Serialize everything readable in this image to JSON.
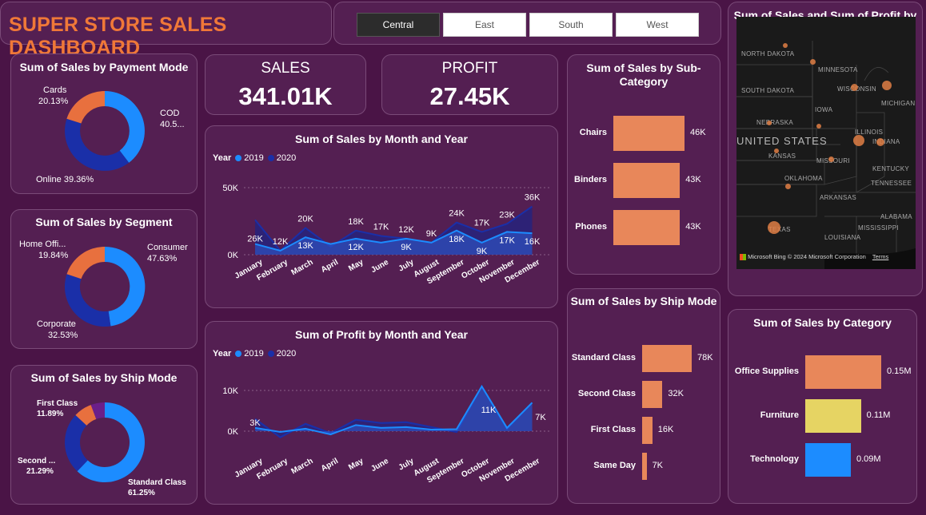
{
  "header": {
    "title": "SUPER STORE SALES DASHBOARD"
  },
  "slicer": {
    "options": [
      "Central",
      "East",
      "South",
      "West"
    ],
    "selected": "Central"
  },
  "kpis": {
    "sales": {
      "label": "SALES",
      "value": "341.01K"
    },
    "profit": {
      "label": "PROFIT",
      "value": "27.45K"
    }
  },
  "payment_mode": {
    "title": "Sum of Sales by Payment Mode",
    "labels": {
      "cards_name": "Cards",
      "cards_pct": "20.13%",
      "cod_name": "COD",
      "cod_pct": "40.5...",
      "online": "Online 39.36%"
    }
  },
  "segment": {
    "title": "Sum of Sales by Segment",
    "labels": {
      "home_name": "Home Offi...",
      "home_pct": "19.84%",
      "consumer_name": "Consumer",
      "consumer_pct": "47.63%",
      "corporate_name": "Corporate",
      "corporate_pct": "32.53%"
    }
  },
  "ship_donut": {
    "title": "Sum of Sales by Ship Mode",
    "labels": {
      "first_name": "First Class",
      "first_pct": "11.89%",
      "second_name": "Second ...",
      "second_pct": "21.29%",
      "standard_name": "Standard Class",
      "standard_pct": "61.25%"
    }
  },
  "sales_month": {
    "title": "Sum of Sales by Month and Year",
    "legend_title": "Year",
    "legend": [
      "2019",
      "2020"
    ],
    "yticks": [
      "50K",
      "0K"
    ],
    "months": [
      "January",
      "February",
      "March",
      "April",
      "May",
      "June",
      "July",
      "August",
      "September",
      "October",
      "November",
      "December"
    ],
    "labels_2019": [
      "",
      "12K",
      "13K",
      "",
      "12K",
      "",
      "9K",
      "",
      "18K",
      "9K",
      "17K",
      "16K"
    ],
    "labels_2020": [
      "26K",
      "",
      "20K",
      "",
      "18K",
      "17K",
      "12K",
      "9K",
      "24K",
      "17K",
      "23K",
      "36K"
    ]
  },
  "profit_month": {
    "title": "Sum of Profit by Month and Year",
    "legend_title": "Year",
    "legend": [
      "2019",
      "2020"
    ],
    "yticks": [
      "10K",
      "0K"
    ],
    "months": [
      "January",
      "February",
      "March",
      "April",
      "May",
      "June",
      "July",
      "August",
      "September",
      "October",
      "November",
      "December"
    ],
    "labels": {
      "jan": "3K",
      "oct": "11K",
      "dec": "7K"
    }
  },
  "subcategory": {
    "title": "Sum of Sales by Sub-Category",
    "bars": [
      {
        "name": "Chairs",
        "value": "46K"
      },
      {
        "name": "Binders",
        "value": "43K"
      },
      {
        "name": "Phones",
        "value": "43K"
      }
    ]
  },
  "shipmode_bar": {
    "title": "Sum of Sales by Ship Mode",
    "bars": [
      {
        "name": "Standard Class",
        "value": "78K"
      },
      {
        "name": "Second Class",
        "value": "32K"
      },
      {
        "name": "First Class",
        "value": "16K"
      },
      {
        "name": "Same Day",
        "value": "7K"
      }
    ]
  },
  "map": {
    "title": "Sum of Sales and Sum of Profit by State",
    "states": [
      "NORTH DAKOTA",
      "MINNESOTA",
      "SOUTH DAKOTA",
      "WISCONSIN",
      "MICHIGAN",
      "IOWA",
      "NEBRASKA",
      "UNITED STATES",
      "ILLINOIS",
      "INDIANA",
      "KANSAS",
      "MISSOURI",
      "KENTUCKY",
      "OKLAHOMA",
      "TENNESSEE",
      "ARKANSAS",
      "ALABAMA",
      "MISSISSIPPI",
      "TEXAS",
      "LOUISIANA"
    ],
    "attribution": {
      "bing": "Microsoft Bing",
      "copyright": "© 2024 Microsoft Corporation",
      "terms": "Terms"
    }
  },
  "category": {
    "title": "Sum of Sales by Category",
    "bars": [
      {
        "name": "Office Supplies",
        "value": "0.15M"
      },
      {
        "name": "Furniture",
        "value": "0.11M"
      },
      {
        "name": "Technology",
        "value": "0.09M"
      }
    ]
  },
  "colors": {
    "orange": "#e8875a",
    "blue_light": "#1c8cff",
    "navy": "#1a2fa8",
    "yellow": "#e6d463",
    "purple": "#6b1f8a",
    "card": "#541f52"
  },
  "chart_data": [
    {
      "type": "pie",
      "title": "Sum of Sales by Payment Mode",
      "categories": [
        "COD",
        "Online",
        "Cards"
      ],
      "values": [
        40.51,
        39.36,
        20.13
      ]
    },
    {
      "type": "pie",
      "title": "Sum of Sales by Segment",
      "categories": [
        "Consumer",
        "Corporate",
        "Home Office"
      ],
      "values": [
        47.63,
        32.53,
        19.84
      ]
    },
    {
      "type": "pie",
      "title": "Sum of Sales by Ship Mode",
      "categories": [
        "Standard Class",
        "Second Class",
        "First Class",
        "Same Day"
      ],
      "values": [
        61.25,
        21.29,
        11.89,
        5.57
      ]
    },
    {
      "type": "area",
      "title": "Sum of Sales by Month and Year",
      "categories": [
        "January",
        "February",
        "March",
        "April",
        "May",
        "June",
        "July",
        "August",
        "September",
        "October",
        "November",
        "December"
      ],
      "series": [
        {
          "name": "2019",
          "values": [
            8,
            3,
            13,
            8,
            12,
            9,
            12,
            9,
            18,
            9,
            17,
            16
          ]
        },
        {
          "name": "2020",
          "values": [
            26,
            3,
            20,
            6,
            18,
            14,
            12,
            9,
            24,
            17,
            23,
            36
          ]
        }
      ],
      "ylim": [
        0,
        50000
      ]
    },
    {
      "type": "area",
      "title": "Sum of Profit by Month and Year",
      "categories": [
        "January",
        "February",
        "March",
        "April",
        "May",
        "June",
        "July",
        "August",
        "September",
        "October",
        "November",
        "December"
      ],
      "series": [
        {
          "name": "2019",
          "values": [
            0.8,
            -0.2,
            0.6,
            -0.8,
            1.5,
            0.8,
            1.0,
            0.4,
            0.5,
            11,
            0.8,
            7
          ]
        },
        {
          "name": "2020",
          "values": [
            3,
            -1.5,
            1.8,
            -0.5,
            2.8,
            2.0,
            2.2,
            1.0,
            -0.2,
            11,
            0.5,
            7
          ]
        }
      ],
      "ylim": [
        -2000,
        12000
      ]
    },
    {
      "type": "bar",
      "title": "Sum of Sales by Sub-Category",
      "categories": [
        "Chairs",
        "Binders",
        "Phones"
      ],
      "values": [
        46,
        43,
        43
      ]
    },
    {
      "type": "bar",
      "title": "Sum of Sales by Ship Mode",
      "categories": [
        "Standard Class",
        "Second Class",
        "First Class",
        "Same Day"
      ],
      "values": [
        78,
        32,
        16,
        7
      ]
    },
    {
      "type": "bar",
      "title": "Sum of Sales by Category",
      "categories": [
        "Office Supplies",
        "Furniture",
        "Technology"
      ],
      "values": [
        0.15,
        0.11,
        0.09
      ]
    }
  ]
}
